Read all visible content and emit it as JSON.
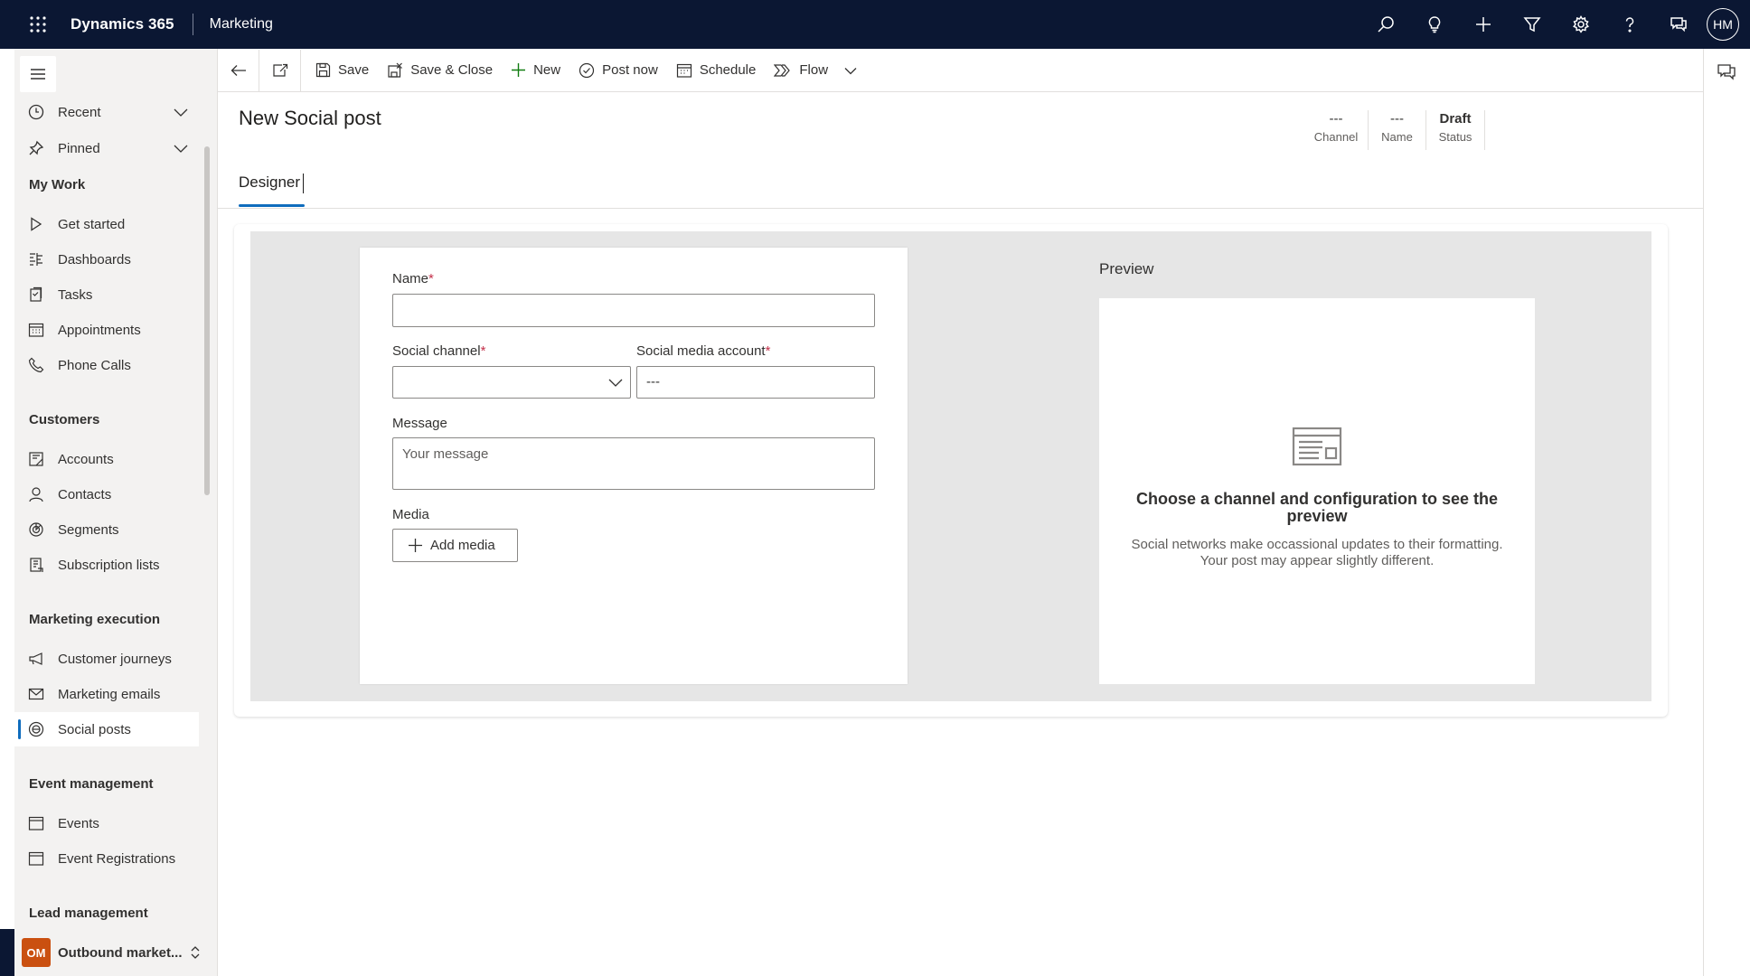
{
  "topbar": {
    "app_name": "Dynamics 365",
    "area_name": "Marketing",
    "user_initials": "HM",
    "icons": [
      "search-icon",
      "lightbulb-icon",
      "plus-icon",
      "filter-icon",
      "gear-icon",
      "help-icon",
      "chat-icon"
    ]
  },
  "nav": {
    "recent": "Recent",
    "pinned": "Pinned",
    "groups": {
      "my_work": "My Work",
      "customers": "Customers",
      "marketing_execution": "Marketing execution",
      "event_management": "Event management",
      "lead_management": "Lead management"
    },
    "items": {
      "get_started": "Get started",
      "dashboards": "Dashboards",
      "tasks": "Tasks",
      "appointments": "Appointments",
      "phone_calls": "Phone Calls",
      "accounts": "Accounts",
      "contacts": "Contacts",
      "segments": "Segments",
      "subscription_lists": "Subscription lists",
      "customer_journeys": "Customer journeys",
      "marketing_emails": "Marketing emails",
      "social_posts": "Social posts",
      "events": "Events",
      "event_registrations": "Event Registrations"
    },
    "selected": "Social posts",
    "area_switcher": {
      "initials": "OM",
      "label": "Outbound market..."
    }
  },
  "commands": {
    "save": "Save",
    "save_close": "Save & Close",
    "new": "New",
    "post_now": "Post now",
    "schedule": "Schedule",
    "flow": "Flow"
  },
  "header": {
    "title": "New Social post",
    "fields": [
      {
        "value": "---",
        "label": "Channel"
      },
      {
        "value": "---",
        "label": "Name"
      },
      {
        "value": "Draft",
        "label": "Status"
      }
    ]
  },
  "tabs": {
    "designer": "Designer"
  },
  "form": {
    "name_label": "Name",
    "name_value": "",
    "social_channel_label": "Social channel",
    "social_channel_value": "",
    "social_media_account_label": "Social media account",
    "social_media_account_value": "---",
    "message_label": "Message",
    "message_placeholder": "Your message",
    "media_label": "Media",
    "add_media": "Add media",
    "required_mark": "*"
  },
  "preview": {
    "title": "Preview",
    "heading": "Choose a channel and configuration to see the preview",
    "subtext": "Social networks make occassional updates to their formatting. Your post may appear slightly different."
  },
  "colors": {
    "topbar_bg": "#0b1733",
    "accent": "#0f6cbd",
    "required": "#c4314b",
    "area_avatar": "#ca5010"
  }
}
